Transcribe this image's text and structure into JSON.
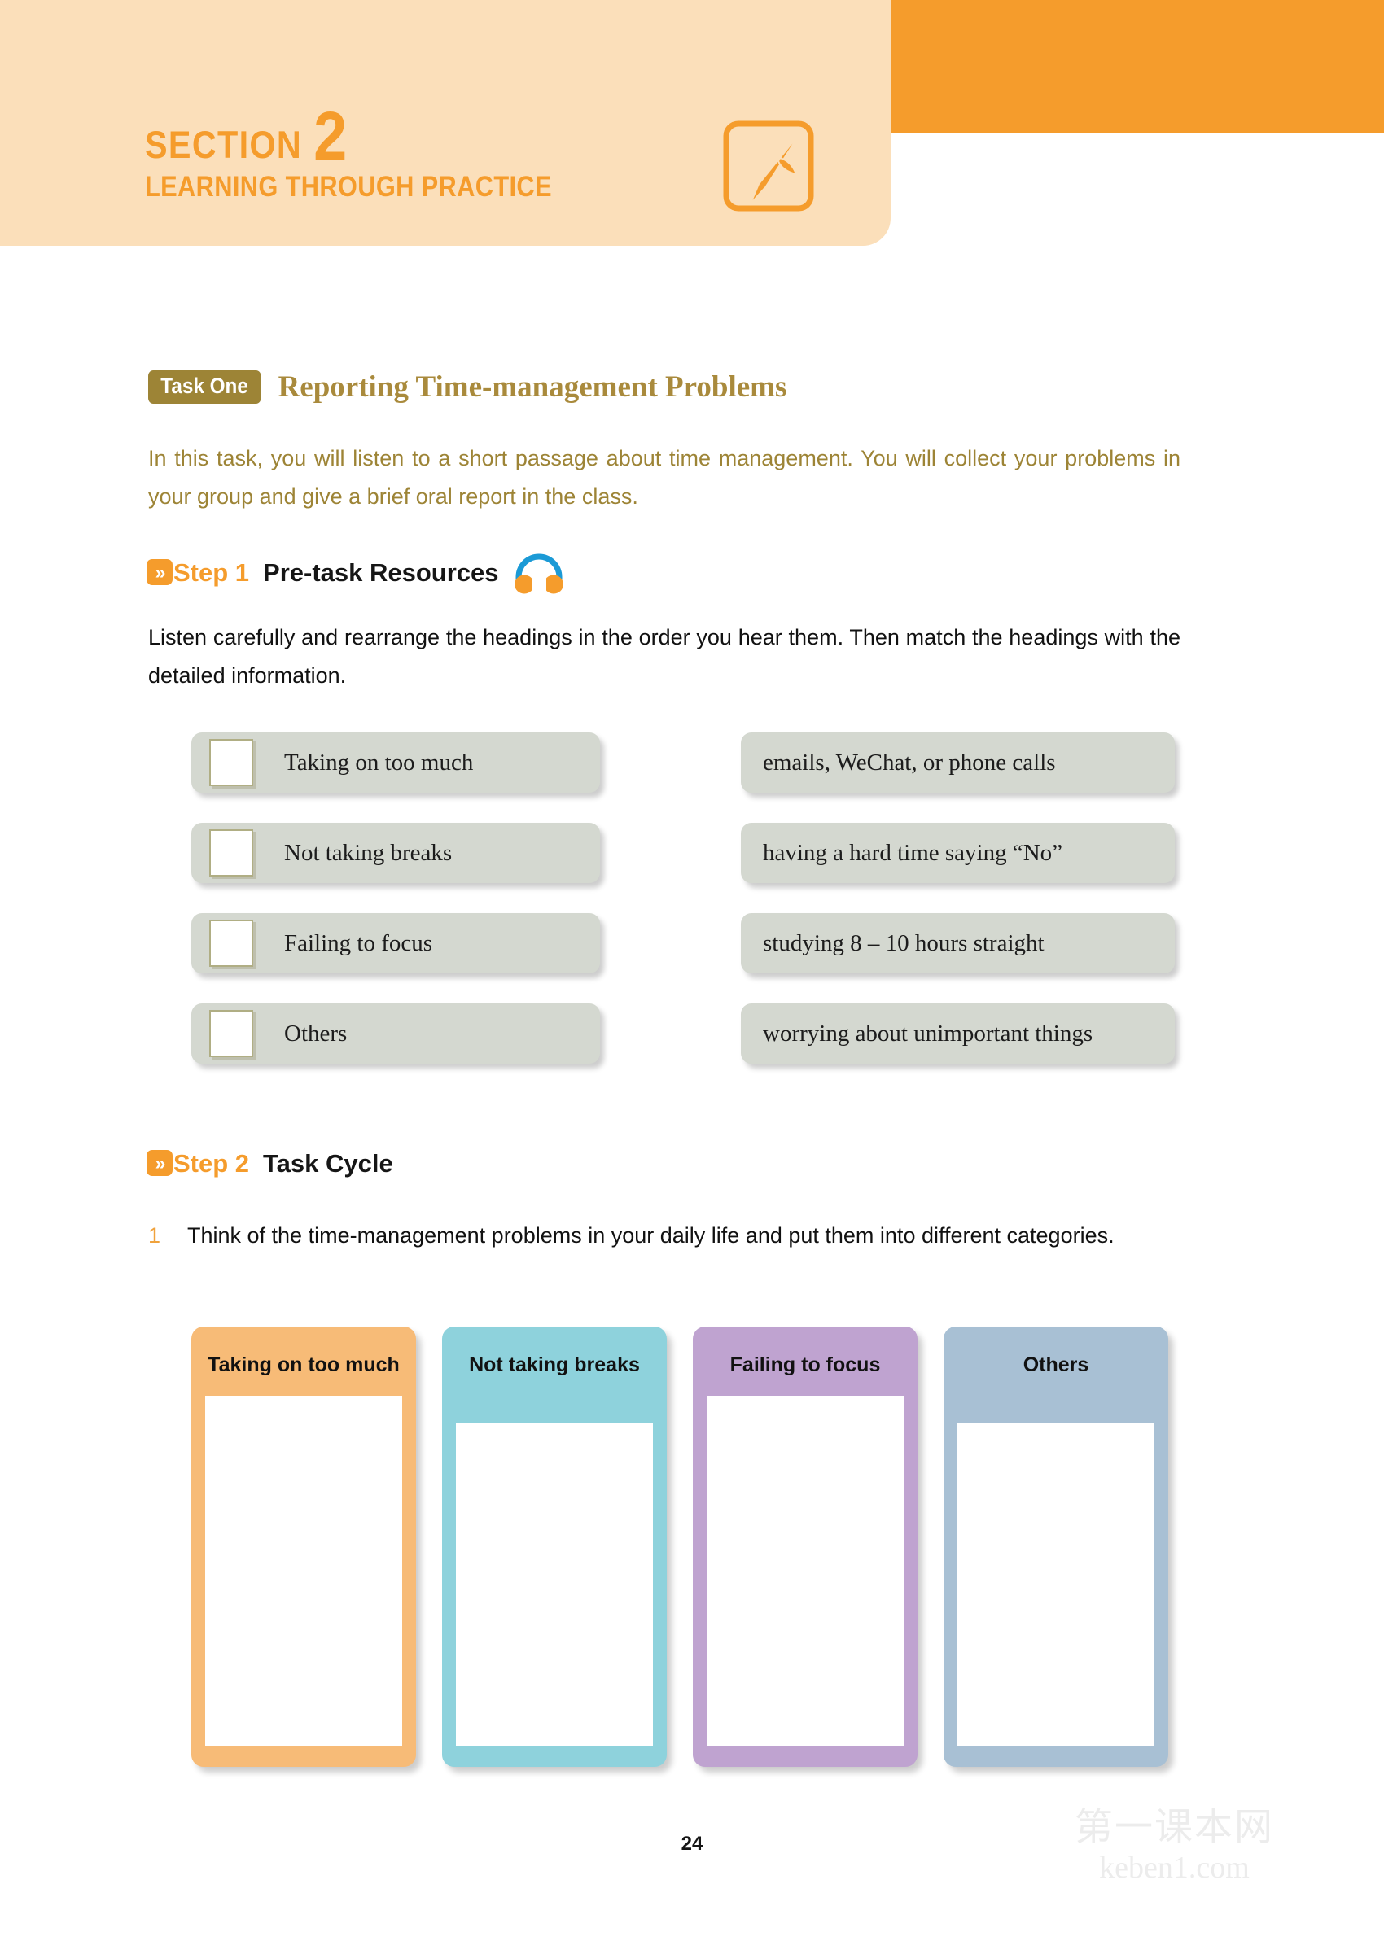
{
  "header": {
    "section_word": "SECTION",
    "section_number": "2",
    "section_subtitle": "LEARNING THROUGH PRACTICE",
    "pen_icon": "pen-nib-icon",
    "accent_orange": "#f59c2c",
    "panel_peach": "#fbdfba"
  },
  "task": {
    "badge": "Task One",
    "title": "Reporting Time-management Problems",
    "badge_color": "#9d8436",
    "title_color": "#a98a3c",
    "intro": "In this task, you will listen to a short passage about time management. You will collect your problems in your group and give a brief oral report in the class."
  },
  "step1": {
    "chevron": "»",
    "number_label": "Step 1",
    "name_label": "Pre-task Resources",
    "icon": "headphones-icon",
    "instruction": "Listen carefully and rearrange the headings in the order you hear them. Then match the headings with the detailed information.",
    "headings": [
      "Taking on too much",
      "Not taking breaks",
      "Failing to focus",
      "Others"
    ],
    "details": [
      "emails, WeChat, or phone calls",
      "having a hard time saying “No”",
      "studying 8 – 10 hours straight",
      "worrying about unimportant things"
    ],
    "box_color": "#d4d8d0"
  },
  "step2": {
    "chevron": "»",
    "number_label": "Step 2",
    "name_label": "Task Cycle",
    "item_number": "1",
    "item_text": "Think of the time-management problems in your daily life and put them into different categories.",
    "cards": [
      {
        "title": "Taking on too much",
        "color": "#f7bb77",
        "lines": 2
      },
      {
        "title": "Not taking breaks",
        "color": "#8ed2dc",
        "lines": 1
      },
      {
        "title": "Failing to focus",
        "color": "#bfa3d0",
        "lines": 2
      },
      {
        "title": "Others",
        "color": "#a8c0d4",
        "lines": 1
      }
    ]
  },
  "footer": {
    "page_number": "24",
    "watermark_cn": "第一课本网",
    "watermark_url": "keben1.com"
  }
}
